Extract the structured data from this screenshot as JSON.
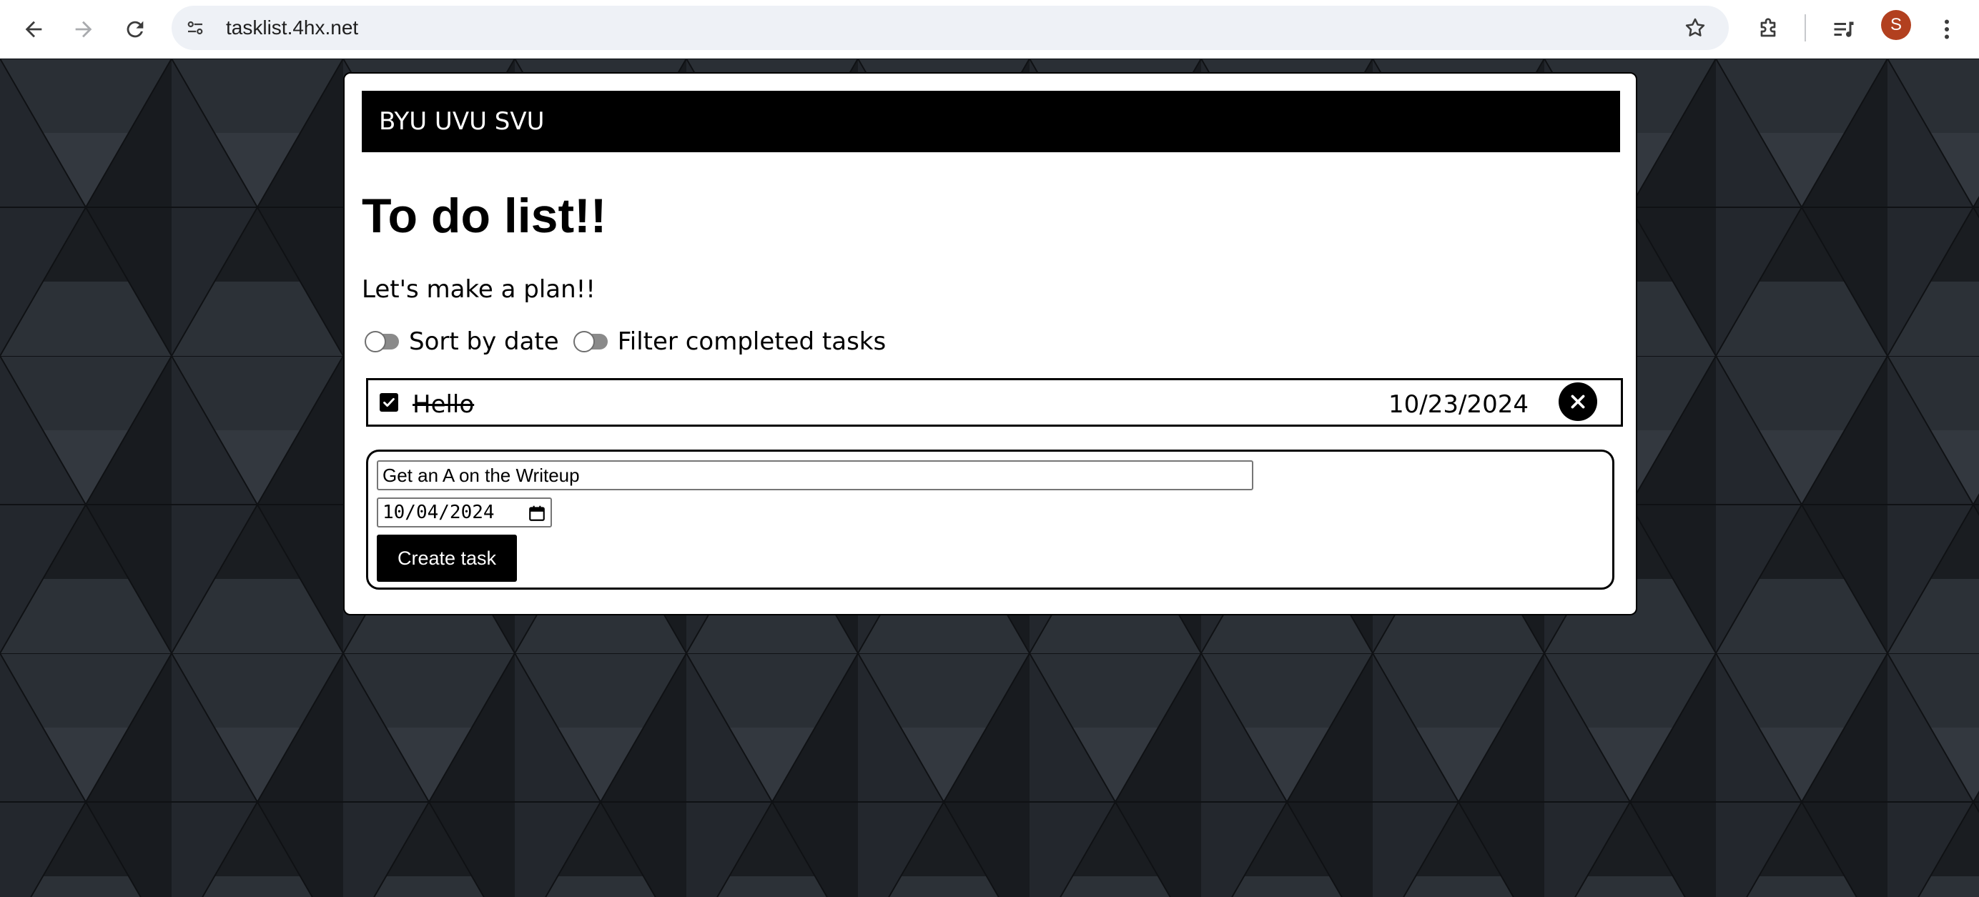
{
  "browser": {
    "url": "tasklist.4hx.net",
    "avatar_initial": "S",
    "icons": [
      "back-arrow-icon",
      "forward-arrow-icon",
      "reload-icon",
      "site-info-icon",
      "bookmark-star-icon",
      "extensions-icon",
      "media-controls-icon",
      "more-menu-icon"
    ]
  },
  "header": {
    "brand": "BYU UVU SVU"
  },
  "main": {
    "title": "To do list!!",
    "subtitle": "Let's make a plan!!",
    "toggles": [
      {
        "label": "Sort by date",
        "on": false
      },
      {
        "label": "Filter completed tasks",
        "on": false
      }
    ],
    "tasks": [
      {
        "name": "Hello",
        "date": "10/23/2024",
        "completed": true
      }
    ],
    "form": {
      "task_value": "Get an A on the Writeup",
      "date_value": "10/04/2024",
      "submit_label": "Create task"
    }
  },
  "colors": {
    "header_bg": "#000000",
    "page_bg": "#1e2227",
    "avatar_bg": "#b2401f"
  }
}
